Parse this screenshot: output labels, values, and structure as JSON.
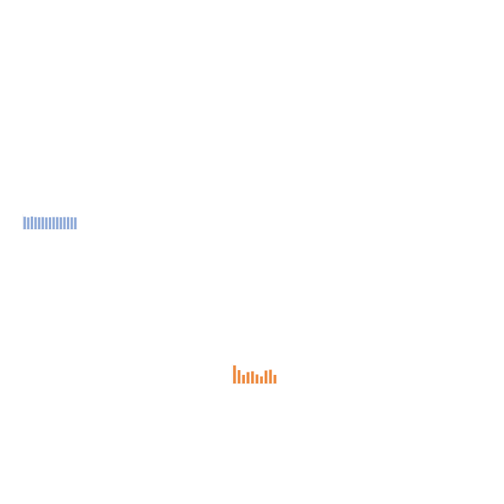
{
  "chart_data": [
    {
      "type": "bar",
      "title": "",
      "xlabel": "",
      "ylabel": "",
      "categories": [],
      "ylim": [
        0,
        100
      ],
      "grid": false,
      "legend": "none",
      "series": [
        {
          "values": [
            82,
            78,
            84,
            80,
            79,
            80,
            78,
            79,
            80,
            80,
            79,
            80,
            80,
            79,
            78
          ]
        }
      ],
      "colors": {
        "bar": "#8ea9d8",
        "bar_edge": "#6f8fc8"
      }
    },
    {
      "type": "bar",
      "title": "",
      "xlabel": "",
      "ylabel": "",
      "categories": [],
      "ylim": [
        0,
        100
      ],
      "grid": false,
      "legend": "none",
      "series": [
        {
          "values": [
            92,
            68,
            44,
            58,
            62,
            46,
            36,
            66,
            70,
            44
          ]
        }
      ],
      "colors": {
        "bar": "#ed8a3f"
      }
    }
  ]
}
